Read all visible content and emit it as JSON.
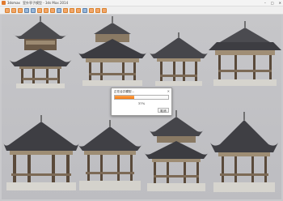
{
  "app": {
    "name": "3dsmax",
    "window_title": "室外亭子模型 - 3ds Max 2014"
  },
  "window_controls": [
    "–",
    "□",
    "✕"
  ],
  "toolbar": {
    "icons": [
      "new-icon",
      "open-icon",
      "save-icon",
      "undo-icon",
      "redo-icon",
      "link-icon",
      "unlink-icon",
      "bind-icon",
      "select-icon",
      "move-icon",
      "rotate-icon",
      "scale-icon",
      "snap-icon",
      "mirror-icon",
      "align-icon",
      "render-icon"
    ]
  },
  "progress_dialog": {
    "title": "正在合并模型...",
    "close": "✕",
    "progress_percent": 37,
    "progress_label": "37%",
    "cancel_label": "取消"
  }
}
